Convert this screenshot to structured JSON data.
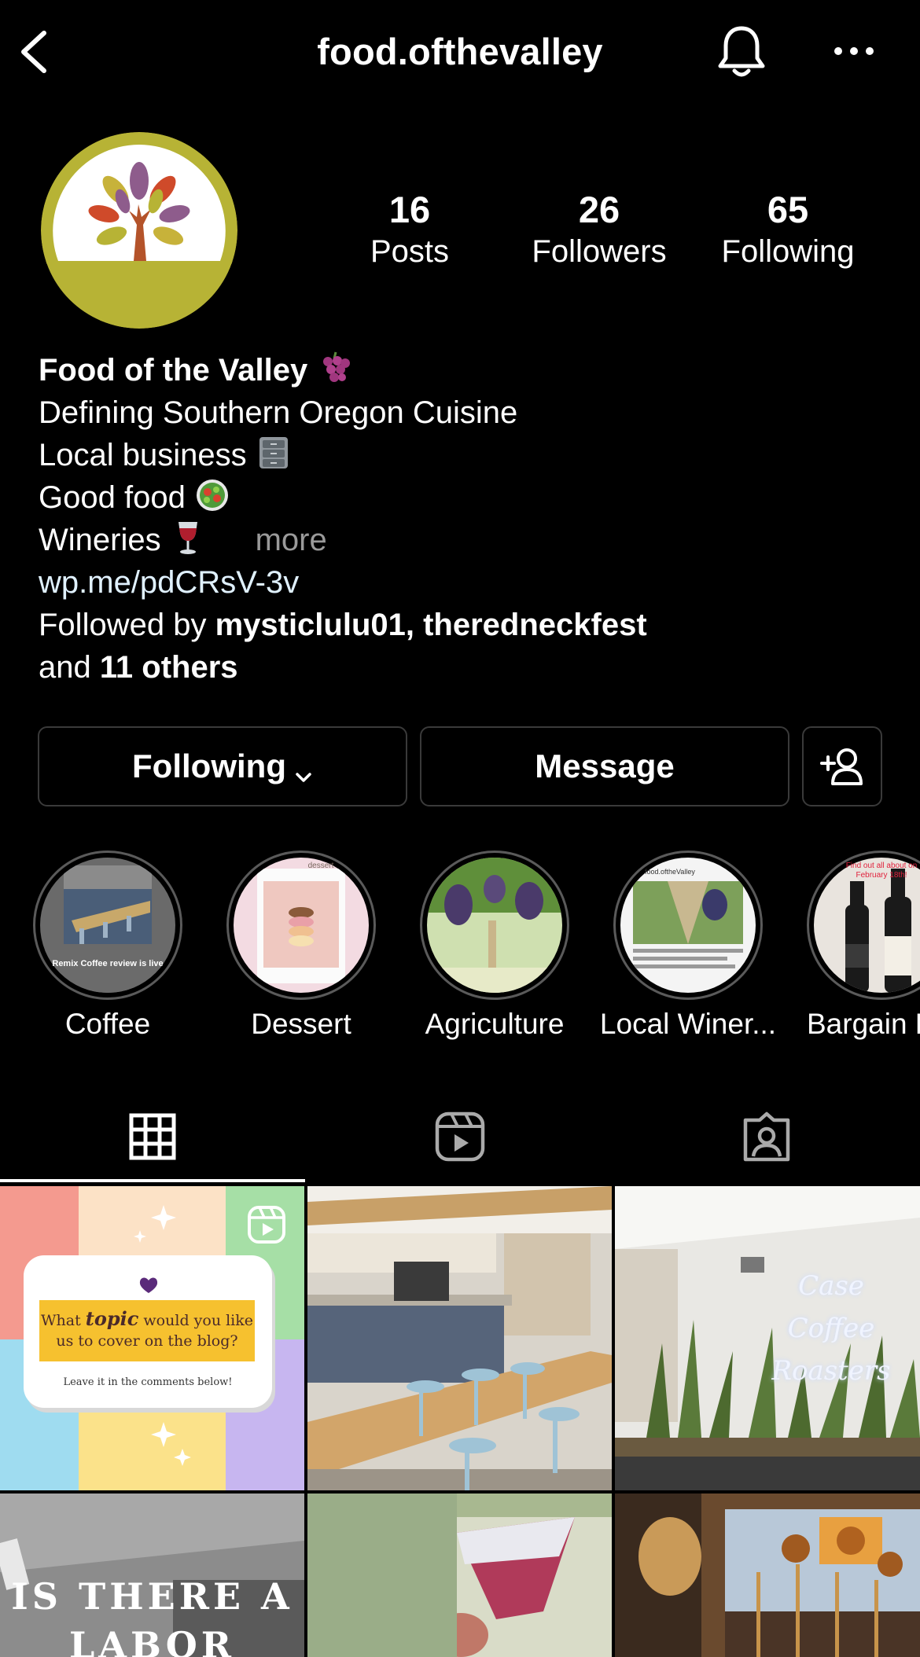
{
  "header": {
    "username": "food.ofthevalley"
  },
  "stats": [
    {
      "value": "16",
      "label": "Posts"
    },
    {
      "value": "26",
      "label": "Followers"
    },
    {
      "value": "65",
      "label": "Following"
    }
  ],
  "bio": {
    "name": "Food of the Valley",
    "line1": "Defining Southern Oregon Cuisine",
    "line2": "Local business",
    "line3": "Good food",
    "line4": "Wineries",
    "more": "more",
    "link": "wp.me/pdCRsV-3v",
    "followed_prefix": "Followed by ",
    "followed_users": "mysticlulu01, theredneckfest",
    "followed_and": "and ",
    "followed_others": "11 others"
  },
  "buttons": {
    "following": "Following",
    "message": "Message"
  },
  "highlights": [
    {
      "label": "Coffee",
      "caption": "Remix Coffee review is live"
    },
    {
      "label": "Dessert",
      "caption": "dessert"
    },
    {
      "label": "Agriculture"
    },
    {
      "label": "Local Winer...",
      "caption": "food.oftheValley"
    },
    {
      "label": "Bargain P",
      "caption": "Find out all about on February 18th!"
    }
  ],
  "posts": {
    "post1": {
      "question_pre": "What",
      "question_topic": "topic",
      "question_mid": "would you like",
      "question_line2": "us to cover on the blog?",
      "footer": "Leave it in the comments below!"
    },
    "post3_sign_line1": "Case Coffee",
    "post3_sign_line2": "Roasters",
    "post4_line1": "IS THERE A",
    "post4_line2": "LABOR"
  },
  "colors": {
    "background": "#000000",
    "text": "#ffffff",
    "muted": "#9a9a9a",
    "link": "#e0f1ff",
    "button_border": "#3a3a3a",
    "avatar_olive": "#b7b335"
  },
  "icons": {
    "back": "chevron-left-icon",
    "bell": "bell-icon",
    "more": "more-horizontal-icon",
    "add_person": "add-person-icon",
    "grid": "grid-icon",
    "reels": "reels-icon",
    "tagged": "tagged-icon"
  }
}
